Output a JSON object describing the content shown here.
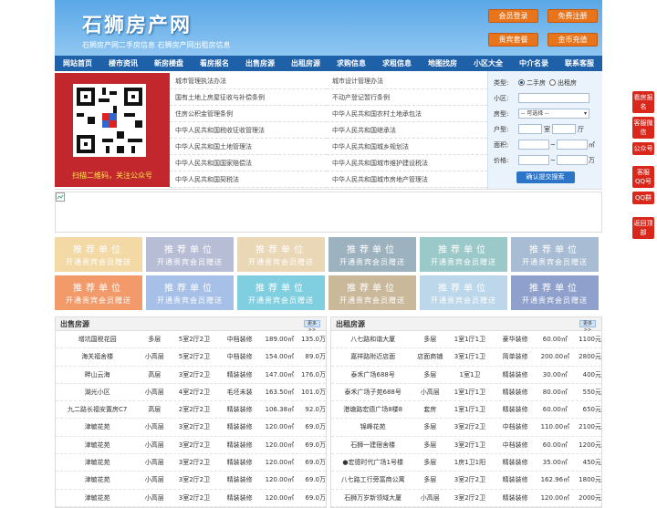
{
  "header": {
    "logo": "石狮房产网",
    "slogan": "石狮房产网二手房信息   石狮房产网出租房信息",
    "buttons": [
      "会员登录",
      "免费注册",
      "贵宾套餐",
      "金币充值"
    ]
  },
  "nav": [
    "网站首页",
    "楼市资讯",
    "新房楼盘",
    "看房报名",
    "出售房源",
    "出租房源",
    "求购信息",
    "求租信息",
    "地图找房",
    "小区大全",
    "中介名录",
    "联系客服"
  ],
  "qr_caption": "扫描二维码，关注公众号",
  "links": [
    "城市管理执法办法",
    "城市设计管理办法",
    "国有土地上房屋征收与补偿条例",
    "不动产登记暂行条例",
    "住房公积金管理条例",
    "中华人民共和国农村土地承包法",
    "中华人民共和国税收征收管理法",
    "中华人民共和国继承法",
    "中华人民共和国土地管理法",
    "中华人民共和国城乡规划法",
    "中华人民共和国国家赔偿法",
    "中华人民共和国城市维护建设税法",
    "中华人民共和国契税法",
    "中华人民共和国城市房地产管理法"
  ],
  "search": {
    "type_label": "类型:",
    "opt1": "二手房",
    "opt2": "出租房",
    "area_label": "小区:",
    "house_label": "房型:",
    "select": "-- 可选择 --",
    "layout_label": "户型:",
    "room": "室",
    "hall": "厅",
    "size_label": "面积:",
    "size_unit": "㎡",
    "price_label": "价格:",
    "price_unit": "万",
    "tilde": "~",
    "submit": "确认提交搜索"
  },
  "tiles": {
    "line1": "推荐单位",
    "line2": "开通贵宾会员赠送",
    "colors": [
      "#f2d9a6",
      "#b8bdd6",
      "#ead7b6",
      "#9db2bf",
      "#9bc8c8",
      "#a8bcd4",
      "#f29a6a",
      "#a6c0e8",
      "#7fcfe0",
      "#c9b99a",
      "#bcd7ea",
      "#8fa0cc"
    ]
  },
  "sale": {
    "title": "出售房源",
    "more": "更多>>",
    "rows": [
      [
        "增坑国税花园",
        "多层",
        "5室2厅2卫",
        "中档装修",
        "189.00㎡",
        "135.0万"
      ],
      [
        "海关福舍楼",
        "小高层",
        "5室2厅2卫",
        "中档装修",
        "154.00㎡",
        "89.0万"
      ],
      [
        "畔山云海",
        "高层",
        "3室2厅2卫",
        "精装装修",
        "147.00㎡",
        "176.0万"
      ],
      [
        "湖光小区",
        "小高层",
        "4室2厅2卫",
        "毛坯未装",
        "163.50㎡",
        "101.0万"
      ],
      [
        "九二路长福安置房C7",
        "高层",
        "2室2厅2卫",
        "精装装修",
        "106.38㎡",
        "92.0万"
      ],
      [
        "津毓花苑",
        "小高层",
        "3室2厅2卫",
        "精装装修",
        "120.00㎡",
        "69.0万"
      ],
      [
        "津毓花苑",
        "小高层",
        "3室2厅2卫",
        "精装装修",
        "120.00㎡",
        "69.0万"
      ],
      [
        "津毓花苑",
        "小高层",
        "3室2厅2卫",
        "精装装修",
        "120.00㎡",
        "69.0万"
      ],
      [
        "津毓花苑",
        "小高层",
        "3室2厅2卫",
        "精装装修",
        "120.00㎡",
        "69.0万"
      ],
      [
        "津毓花苑",
        "小高层",
        "3室2厅2卫",
        "精装装修",
        "120.00㎡",
        "69.0万"
      ]
    ]
  },
  "rent": {
    "title": "出租房源",
    "more": "更多>>",
    "rows": [
      [
        "八七路和谐大厦",
        "多层",
        "1室1厅1卫",
        "豪华装修",
        "60.00㎡",
        "1100元"
      ],
      [
        "嘉祥路附近店面",
        "店面商铺",
        "3室1厅1卫",
        "简单装修",
        "200.00㎡",
        "2800元"
      ],
      [
        "泰禾广场688号",
        "多层",
        "1室1卫",
        "精装装修",
        "30.00㎡",
        "400元"
      ],
      [
        "泰禾广场子苑688号",
        "小高层",
        "1室1厅1卫",
        "精装装修",
        "80.00㎡",
        "550元"
      ],
      [
        "港塘路宏德广场8楼8",
        "套房",
        "1室1厅1卫",
        "精装装修",
        "60.00㎡",
        "650元"
      ],
      [
        "锦峰花苑",
        "多层",
        "3室2厅2卫",
        "中档装修",
        "110.00㎡",
        "2100元"
      ],
      [
        "石狮一建宿舍楼",
        "多层",
        "3室2厅1卫",
        "中档装修",
        "60.00㎡",
        "1200元"
      ],
      [
        "●宏德时代广场1号楼",
        "多层",
        "1房1卫1阳",
        "精装装修",
        "35.00㎡",
        "450元"
      ],
      [
        "八七路工行旁富商公寓",
        "多层",
        "3室2厅2卫",
        "精装装修",
        "162.96㎡",
        "1800元"
      ],
      [
        "石狮万岁新领域大厦",
        "小高层",
        "3室2厅2卫",
        "精装装修",
        "120.00㎡",
        "2000元"
      ]
    ]
  },
  "sidebar": [
    "看房报名",
    "客服微信",
    "公众号",
    "客服QQ号",
    "QQ群",
    "返回顶部"
  ]
}
